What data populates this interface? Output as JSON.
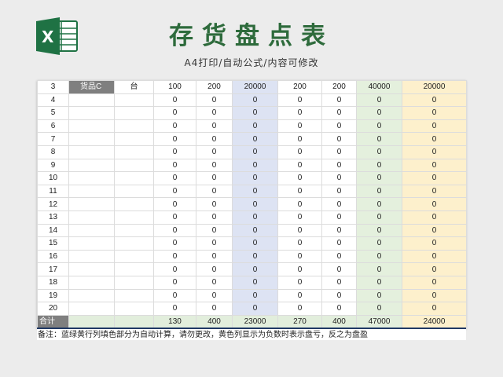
{
  "header": {
    "title": "存货盘点表",
    "subtitle": "A4打印/自动公式/内容可修改",
    "logo_icon": "excel-logo-icon",
    "logo_color": "#1f7244"
  },
  "table": {
    "rows": [
      {
        "no": "3",
        "product": "货品C",
        "unit": "台",
        "c4": "100",
        "c5": "200",
        "c6": "20000",
        "c7": "200",
        "c8": "200",
        "c9": "40000",
        "c10": "20000"
      },
      {
        "no": "4",
        "product": "",
        "unit": "",
        "c4": "0",
        "c5": "0",
        "c6": "0",
        "c7": "0",
        "c8": "0",
        "c9": "0",
        "c10": "0"
      },
      {
        "no": "5",
        "product": "",
        "unit": "",
        "c4": "0",
        "c5": "0",
        "c6": "0",
        "c7": "0",
        "c8": "0",
        "c9": "0",
        "c10": "0"
      },
      {
        "no": "6",
        "product": "",
        "unit": "",
        "c4": "0",
        "c5": "0",
        "c6": "0",
        "c7": "0",
        "c8": "0",
        "c9": "0",
        "c10": "0"
      },
      {
        "no": "7",
        "product": "",
        "unit": "",
        "c4": "0",
        "c5": "0",
        "c6": "0",
        "c7": "0",
        "c8": "0",
        "c9": "0",
        "c10": "0"
      },
      {
        "no": "8",
        "product": "",
        "unit": "",
        "c4": "0",
        "c5": "0",
        "c6": "0",
        "c7": "0",
        "c8": "0",
        "c9": "0",
        "c10": "0"
      },
      {
        "no": "9",
        "product": "",
        "unit": "",
        "c4": "0",
        "c5": "0",
        "c6": "0",
        "c7": "0",
        "c8": "0",
        "c9": "0",
        "c10": "0"
      },
      {
        "no": "10",
        "product": "",
        "unit": "",
        "c4": "0",
        "c5": "0",
        "c6": "0",
        "c7": "0",
        "c8": "0",
        "c9": "0",
        "c10": "0"
      },
      {
        "no": "11",
        "product": "",
        "unit": "",
        "c4": "0",
        "c5": "0",
        "c6": "0",
        "c7": "0",
        "c8": "0",
        "c9": "0",
        "c10": "0"
      },
      {
        "no": "12",
        "product": "",
        "unit": "",
        "c4": "0",
        "c5": "0",
        "c6": "0",
        "c7": "0",
        "c8": "0",
        "c9": "0",
        "c10": "0"
      },
      {
        "no": "13",
        "product": "",
        "unit": "",
        "c4": "0",
        "c5": "0",
        "c6": "0",
        "c7": "0",
        "c8": "0",
        "c9": "0",
        "c10": "0"
      },
      {
        "no": "14",
        "product": "",
        "unit": "",
        "c4": "0",
        "c5": "0",
        "c6": "0",
        "c7": "0",
        "c8": "0",
        "c9": "0",
        "c10": "0"
      },
      {
        "no": "15",
        "product": "",
        "unit": "",
        "c4": "0",
        "c5": "0",
        "c6": "0",
        "c7": "0",
        "c8": "0",
        "c9": "0",
        "c10": "0"
      },
      {
        "no": "16",
        "product": "",
        "unit": "",
        "c4": "0",
        "c5": "0",
        "c6": "0",
        "c7": "0",
        "c8": "0",
        "c9": "0",
        "c10": "0"
      },
      {
        "no": "17",
        "product": "",
        "unit": "",
        "c4": "0",
        "c5": "0",
        "c6": "0",
        "c7": "0",
        "c8": "0",
        "c9": "0",
        "c10": "0"
      },
      {
        "no": "18",
        "product": "",
        "unit": "",
        "c4": "0",
        "c5": "0",
        "c6": "0",
        "c7": "0",
        "c8": "0",
        "c9": "0",
        "c10": "0"
      },
      {
        "no": "19",
        "product": "",
        "unit": "",
        "c4": "0",
        "c5": "0",
        "c6": "0",
        "c7": "0",
        "c8": "0",
        "c9": "0",
        "c10": "0"
      },
      {
        "no": "20",
        "product": "",
        "unit": "",
        "c4": "0",
        "c5": "0",
        "c6": "0",
        "c7": "0",
        "c8": "0",
        "c9": "0",
        "c10": "0"
      }
    ],
    "total": {
      "label": "合计",
      "c4": "130",
      "c5": "400",
      "c6": "23000",
      "c7": "270",
      "c8": "400",
      "c9": "47000",
      "c10": "24000"
    },
    "colors": {
      "blue": "#dde3f3",
      "green": "#e4f0dd",
      "orange": "#fdf0cc",
      "label_gray": "#7f7f7f"
    }
  },
  "note": "备注：蓝绿黄行列填色部分为自动计算，请勿更改，黄色列显示为负数时表示盘亏，反之为盘盈"
}
